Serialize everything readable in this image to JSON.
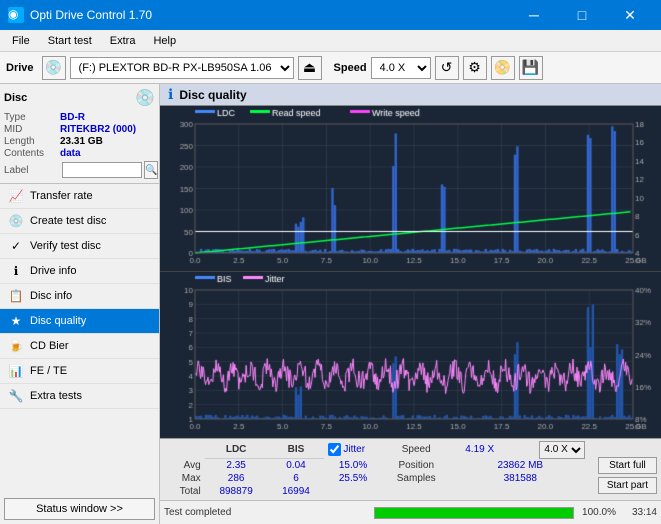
{
  "titlebar": {
    "title": "Opti Drive Control 1.70",
    "icon": "●",
    "minimize": "─",
    "maximize": "□",
    "close": "✕"
  },
  "menubar": {
    "items": [
      "File",
      "Start test",
      "Extra",
      "Help"
    ]
  },
  "drivebar": {
    "drive_label": "Drive",
    "drive_value": "(F:) PLEXTOR BD-R  PX-LB950SA 1.06",
    "speed_label": "Speed",
    "speed_value": "4.0 X"
  },
  "disc": {
    "header": "Disc",
    "type_label": "Type",
    "type_value": "BD-R",
    "mid_label": "MID",
    "mid_value": "RITEKBR2 (000)",
    "length_label": "Length",
    "length_value": "23.31 GB",
    "contents_label": "Contents",
    "contents_value": "data",
    "label_label": "Label"
  },
  "sidebar": {
    "items": [
      {
        "id": "transfer-rate",
        "label": "Transfer rate",
        "icon": "📈"
      },
      {
        "id": "create-test-disc",
        "label": "Create test disc",
        "icon": "💿"
      },
      {
        "id": "verify-test-disc",
        "label": "Verify test disc",
        "icon": "✓"
      },
      {
        "id": "drive-info",
        "label": "Drive info",
        "icon": "ℹ"
      },
      {
        "id": "disc-info",
        "label": "Disc info",
        "icon": "📋"
      },
      {
        "id": "disc-quality",
        "label": "Disc quality",
        "icon": "★",
        "active": true
      },
      {
        "id": "cd-bier",
        "label": "CD Bier",
        "icon": "🍺"
      },
      {
        "id": "fe-te",
        "label": "FE / TE",
        "icon": "📊"
      },
      {
        "id": "extra-tests",
        "label": "Extra tests",
        "icon": "🔧"
      }
    ],
    "status_window": "Status window >>"
  },
  "disc_quality": {
    "title": "Disc quality",
    "legend": [
      {
        "label": "LDC",
        "color": "#4488ff"
      },
      {
        "label": "Read speed",
        "color": "#00ff00"
      },
      {
        "label": "Write speed",
        "color": "#ff00ff"
      }
    ],
    "legend2": [
      {
        "label": "BIS",
        "color": "#4488ff"
      },
      {
        "label": "Jitter",
        "color": "#ff88ff"
      }
    ],
    "chart1": {
      "y_max": 300,
      "y_right_max": 18,
      "x_max": 25,
      "y_ticks": [
        0,
        50,
        100,
        150,
        200,
        250,
        300
      ],
      "y_right_ticks": [
        4,
        6,
        8,
        10,
        12,
        14,
        16,
        18
      ],
      "x_ticks": [
        0.0,
        2.5,
        5.0,
        7.5,
        10.0,
        12.5,
        15.0,
        17.5,
        20.0,
        22.5,
        25.0
      ]
    },
    "chart2": {
      "y_max": 10,
      "y_right_max": 40,
      "x_max": 25,
      "y_ticks": [
        1,
        2,
        3,
        4,
        5,
        6,
        7,
        8,
        9,
        10
      ],
      "y_right_ticks": [
        8,
        16,
        24,
        32,
        40
      ],
      "x_ticks": [
        0.0,
        2.5,
        5.0,
        7.5,
        10.0,
        12.5,
        15.0,
        17.5,
        20.0,
        22.5,
        25.0
      ]
    }
  },
  "stats": {
    "headers": [
      "LDC",
      "BIS",
      "",
      "Jitter",
      "Speed",
      "4.19 X",
      "",
      "4.0 X"
    ],
    "avg_label": "Avg",
    "avg_ldc": "2.35",
    "avg_bis": "0.04",
    "avg_jitter": "15.0%",
    "max_label": "Max",
    "max_ldc": "286",
    "max_bis": "6",
    "max_jitter": "25.5%",
    "total_label": "Total",
    "total_ldc": "898879",
    "total_bis": "16994",
    "position_label": "Position",
    "position_value": "23862 MB",
    "samples_label": "Samples",
    "samples_value": "381588",
    "jitter_checked": true,
    "start_full": "Start full",
    "start_part": "Start part"
  },
  "statusbar": {
    "status_text": "Test completed",
    "progress": 100,
    "progress_label": "100.0%",
    "time": "33:14"
  }
}
